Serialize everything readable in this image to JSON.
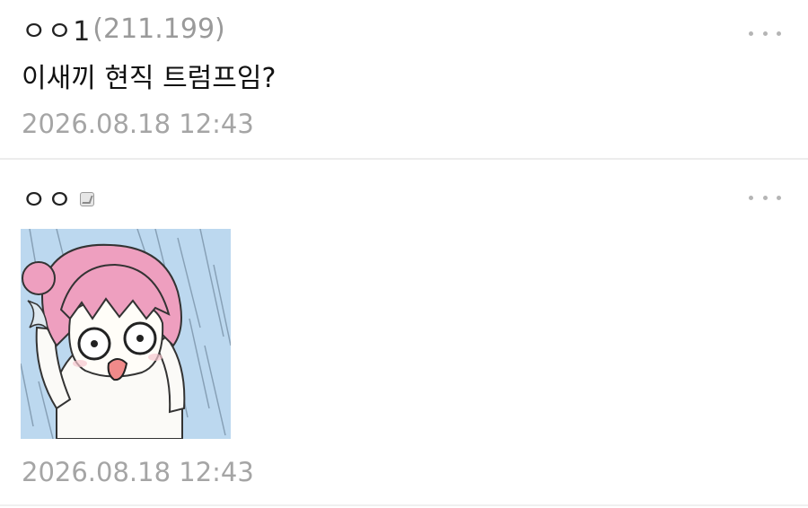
{
  "comments": [
    {
      "nickname": "ㅇㅇ1",
      "ip": "(211.199)",
      "text": "이새끼 현직 트럼프임?",
      "timestamp": "2026.08.18 12:43"
    },
    {
      "nickname": "ㅇㅇ",
      "member_icon": "fixed-nick-icon",
      "image": "anime-girl-in-rain-emoticon",
      "timestamp": "2026.08.18 12:43"
    }
  ],
  "icons": {
    "more": "more-options-icon"
  },
  "colors": {
    "ip": "#9a9a9a",
    "timestamp": "#a5a5a5",
    "divider": "#ececec",
    "emoticon_bg": "#bcd8ef",
    "hair": "#ee9fbf"
  }
}
